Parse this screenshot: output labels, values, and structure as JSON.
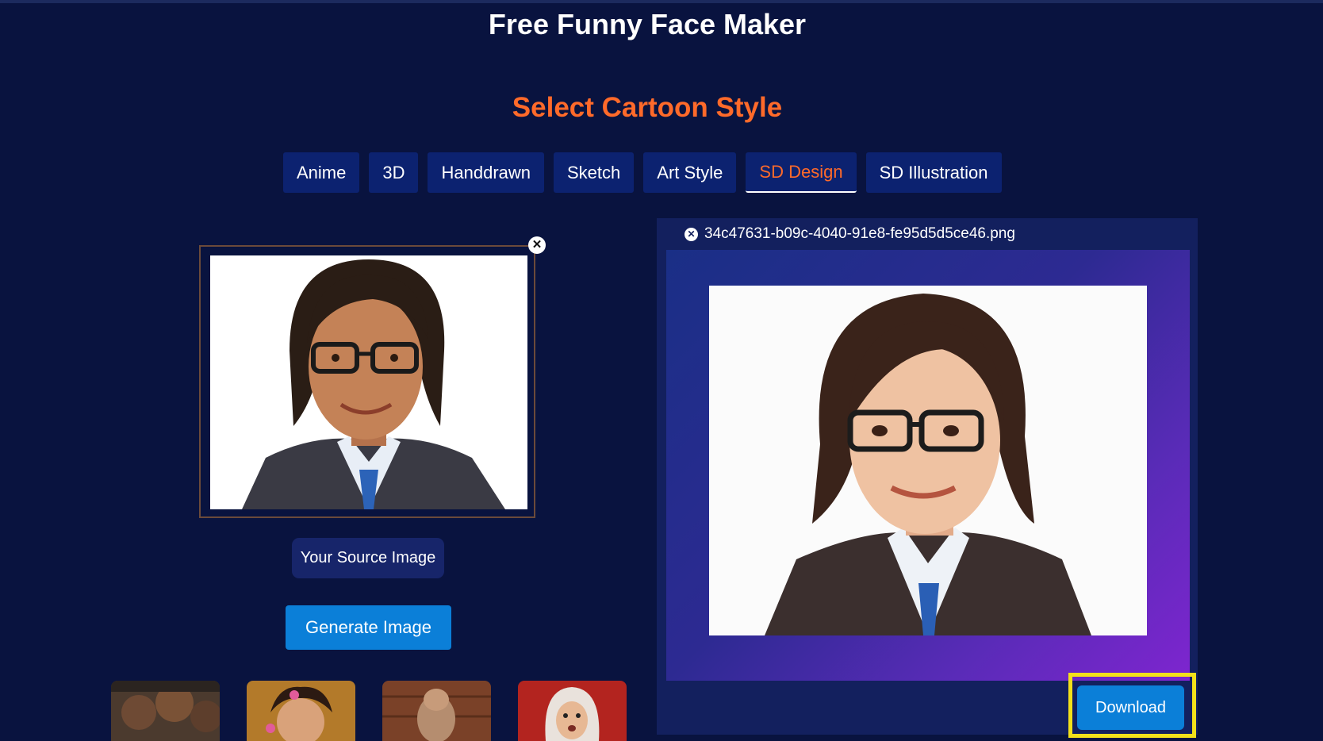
{
  "header": {
    "title": "Free Funny Face Maker"
  },
  "style_section": {
    "title": "Select Cartoon Style",
    "tabs": [
      {
        "label": "Anime",
        "active": false
      },
      {
        "label": "3D",
        "active": false
      },
      {
        "label": "Handdrawn",
        "active": false
      },
      {
        "label": "Sketch",
        "active": false
      },
      {
        "label": "Art Style",
        "active": false
      },
      {
        "label": "SD Design",
        "active": true
      },
      {
        "label": "SD Illustration",
        "active": false
      }
    ]
  },
  "source": {
    "remove_icon": "close-icon",
    "label": "Your Source Image",
    "generate_label": "Generate Image"
  },
  "result": {
    "filename": "34c47631-b09c-4040-91e8-fe95d5d5ce46.png",
    "download_label": "Download"
  },
  "samples": [
    {
      "name": "group-of-children-thumbnail"
    },
    {
      "name": "girl-with-flowers-thumbnail"
    },
    {
      "name": "statue-on-wood-thumbnail"
    },
    {
      "name": "woman-in-headscarf-thumbnail"
    }
  ],
  "colors": {
    "background": "#09133f",
    "accent_orange": "#ff6a2a",
    "tab_bg": "#0c2270",
    "button_blue": "#0b7fd8",
    "highlight_yellow": "#f3e01a"
  }
}
